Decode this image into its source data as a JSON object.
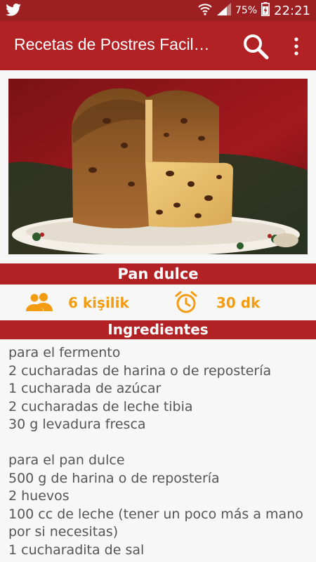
{
  "status": {
    "battery": "75%",
    "time": "22:21"
  },
  "appbar": {
    "title": "Recetas de Postres Facil…"
  },
  "recipe": {
    "name": "Pan dulce",
    "servings": "6 kişilik",
    "time": "30 dk",
    "ingredients_heading": "Ingredientes",
    "ingredients": [
      "para el fermento",
      "2 cucharadas de harina o de repostería",
      "1 cucharada de azúcar",
      "2 cucharadas de leche tibia",
      "30 g levadura fresca",
      "",
      "para el pan dulce",
      "500 g de harina o de repostería",
      "2 huevos",
      "100 cc de leche (tener un poco más a mano",
      "por si necesitas)",
      "1 cucharadita de sal"
    ]
  },
  "colors": {
    "status_bar": "#9c1f22",
    "app_bar": "#b22124",
    "accent": "#f39c12"
  },
  "icons": [
    "twitter-icon",
    "wifi-icon",
    "signal-icon",
    "battery-icon",
    "search-icon",
    "more-vert-icon",
    "people-icon",
    "alarm-icon"
  ]
}
